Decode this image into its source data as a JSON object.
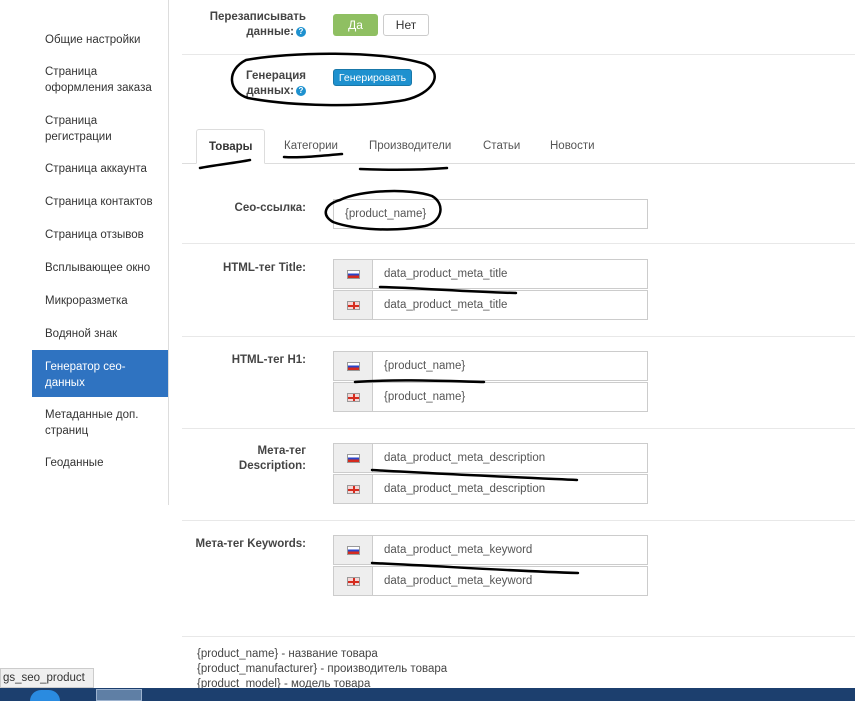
{
  "sidebar": {
    "items": [
      {
        "label": "Общие настройки",
        "active": false
      },
      {
        "label": "Страница оформления заказа",
        "active": false
      },
      {
        "label": "Страница регистрации",
        "active": false
      },
      {
        "label": "Страница аккаунта",
        "active": false
      },
      {
        "label": "Страница контактов",
        "active": false
      },
      {
        "label": "Страница отзывов",
        "active": false
      },
      {
        "label": "Всплывающее окно",
        "active": false
      },
      {
        "label": "Микроразметка",
        "active": false
      },
      {
        "label": "Водяной знак",
        "active": false
      },
      {
        "label": "Генератор сео-данных",
        "active": true
      },
      {
        "label": "Метаданные доп. страниц",
        "active": false
      },
      {
        "label": "Геоданные",
        "active": false
      }
    ]
  },
  "overwrite": {
    "label": "Перезаписывать данные:",
    "yes_label": "Да",
    "no_label": "Нет",
    "selected": "Да"
  },
  "generate": {
    "label": "Генерация данных:",
    "button_label": "Генерировать"
  },
  "tabs": [
    {
      "label": "Товары",
      "active": true
    },
    {
      "label": "Категории",
      "active": false
    },
    {
      "label": "Производители",
      "active": false
    },
    {
      "label": "Статьи",
      "active": false
    },
    {
      "label": "Новости",
      "active": false
    }
  ],
  "fields": {
    "seo_url": {
      "label": "Сео-ссылка:",
      "value": "{product_name}"
    },
    "title": {
      "label": "HTML-тег Title:",
      "ru": "data_product_meta_title",
      "en": "data_product_meta_title"
    },
    "h1": {
      "label": "HTML-тег H1:",
      "ru": "{product_name}",
      "en": "{product_name}"
    },
    "description": {
      "label": "Мета-тег Description:",
      "ru": "data_product_meta_description",
      "en": "data_product_meta_description"
    },
    "keywords": {
      "label": "Мета-тег Keywords:",
      "ru": "data_product_meta_keyword",
      "en": "data_product_meta_keyword"
    }
  },
  "help_lines": [
    "{product_name} - название товара",
    "{product_manufacturer} - производитель товара",
    "{product_model} - модель товара"
  ],
  "status_bar": {
    "text": "gs_seo_product"
  },
  "colors": {
    "active_sidebar": "#2f73c1",
    "yes_button": "#8fbf62",
    "generate_button": "#1e91cf",
    "annotation_ink": "#000000"
  }
}
